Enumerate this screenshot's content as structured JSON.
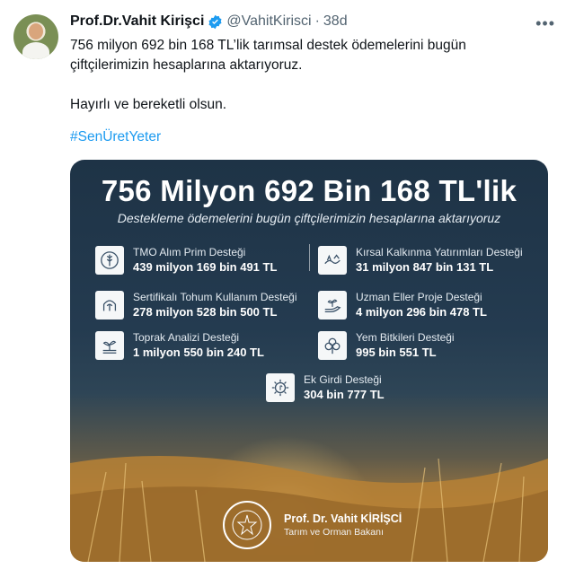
{
  "tweet": {
    "name": "Prof.Dr.Vahit Kirişci",
    "handle": "@VahitKirisci",
    "separator": "·",
    "time": "38d",
    "more": "•••",
    "text_line1": "756 milyon 692 bin 168 TL’lik tarımsal destek ödemelerini bugün",
    "text_line2": "çiftçilerimizin hesaplarına aktarıyoruz.",
    "text_line3": "Hayırlı ve bereketli olsun.",
    "hashtag": "#SenÜretYeter"
  },
  "card": {
    "title": "756 Milyon 692 Bin 168 TL'lik",
    "subtitle": "Destekleme ödemelerini bugün çiftçilerimizin hesaplarına aktarıyoruz",
    "items": [
      {
        "label": "TMO Alım Prim Desteği",
        "value": "439 milyon 169 bin 491 TL",
        "icon": "wheat-icon"
      },
      {
        "label": "Kırsal Kalkınma Yatırımları Desteği",
        "value": "31 milyon 847 bin 131 TL",
        "icon": "rural-development-icon"
      },
      {
        "label": "Sertifikalı Tohum Kullanım Desteği",
        "value": "278 milyon 528 bin 500 TL",
        "icon": "seed-icon"
      },
      {
        "label": "Uzman Eller Proje Desteği",
        "value": "4 milyon 296 bin 478 TL",
        "icon": "hand-plant-icon"
      },
      {
        "label": "Toprak Analizi Desteği",
        "value": "1 milyon 550 bin 240 TL",
        "icon": "sprout-icon"
      },
      {
        "label": "Yem Bitkileri Desteği",
        "value": "995 bin 551 TL",
        "icon": "clover-icon"
      },
      {
        "label": "Ek Girdi Desteği",
        "value": "304 bin 777 TL",
        "icon": "gear-leaf-icon"
      }
    ],
    "footer_name": "Prof. Dr. Vahit KİRİŞCİ",
    "footer_role": "Tarım ve Orman Bakanı"
  },
  "colors": {
    "link": "#1d9bf0",
    "verified": "#1d9bf0",
    "card_bg": "#243b50",
    "field": "#c58c3b"
  }
}
